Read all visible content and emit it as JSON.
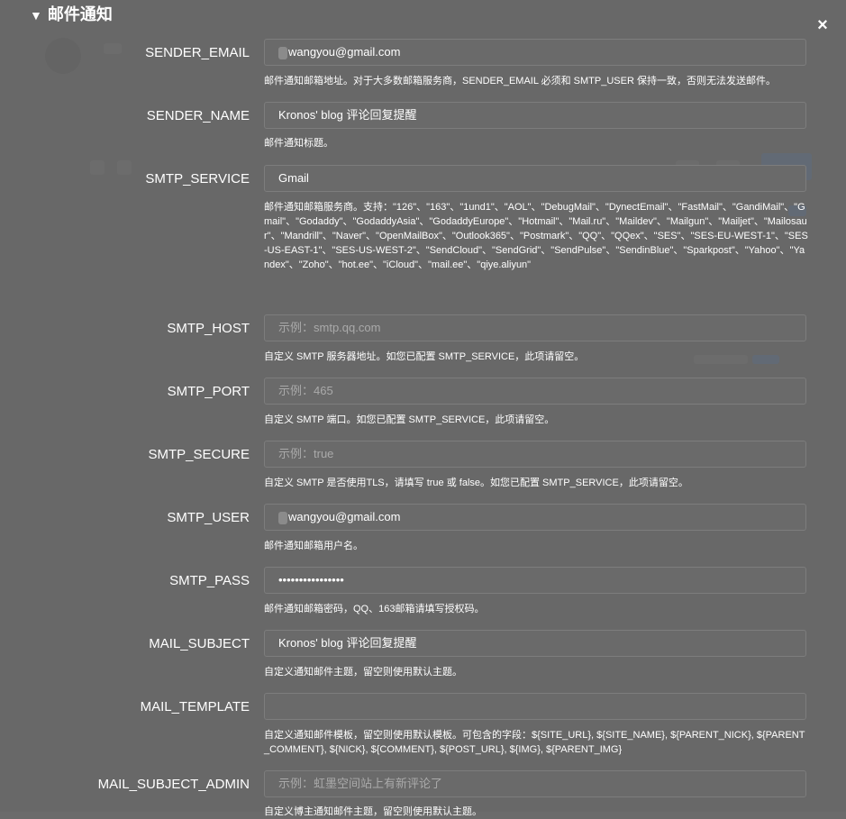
{
  "section": {
    "title": "邮件通知"
  },
  "close_label": "×",
  "fields": [
    {
      "label": "SENDER_EMAIL",
      "value": "wangyou@gmail.com",
      "placeholder": "",
      "help": "邮件通知邮箱地址。对于大多数邮箱服务商，SENDER_EMAIL 必须和 SMTP_USER 保持一致，否则无法发送邮件。"
    },
    {
      "label": "SENDER_NAME",
      "value": "Kronos' blog 评论回复提醒",
      "placeholder": "",
      "help": "邮件通知标题。"
    },
    {
      "label": "SMTP_SERVICE",
      "value": "Gmail",
      "placeholder": "",
      "help": "邮件通知邮箱服务商。支持：\"126\"、\"163\"、\"1und1\"、\"AOL\"、\"DebugMail\"、\"DynectEmail\"、\"FastMail\"、\"GandiMail\"、\"Gmail\"、\"Godaddy\"、\"GodaddyAsia\"、\"GodaddyEurope\"、\"Hotmail\"、\"Mail.ru\"、\"Maildev\"、\"Mailgun\"、\"Mailjet\"、\"Mailosaur\"、\"Mandrill\"、\"Naver\"、\"OpenMailBox\"、\"Outlook365\"、\"Postmark\"、\"QQ\"、\"QQex\"、\"SES\"、\"SES-EU-WEST-1\"、\"SES-US-EAST-1\"、\"SES-US-WEST-2\"、\"SendCloud\"、\"SendGrid\"、\"SendPulse\"、\"SendinBlue\"、\"Sparkpost\"、\"Yahoo\"、\"Yandex\"、\"Zoho\"、\"hot.ee\"、\"iCloud\"、\"mail.ee\"、\"qiye.aliyun\""
    },
    {
      "label": "SMTP_HOST",
      "value": "",
      "placeholder": "示例：smtp.qq.com",
      "help": "自定义 SMTP 服务器地址。如您已配置 SMTP_SERVICE，此项请留空。"
    },
    {
      "label": "SMTP_PORT",
      "value": "",
      "placeholder": "示例：465",
      "help": "自定义 SMTP 端口。如您已配置 SMTP_SERVICE，此项请留空。"
    },
    {
      "label": "SMTP_SECURE",
      "value": "",
      "placeholder": "示例：true",
      "help": "自定义 SMTP 是否使用TLS，请填写 true 或 false。如您已配置 SMTP_SERVICE，此项请留空。"
    },
    {
      "label": "SMTP_USER",
      "value": "wangyou@gmail.com",
      "placeholder": "",
      "help": "邮件通知邮箱用户名。"
    },
    {
      "label": "SMTP_PASS",
      "value": "••••••••••••••••",
      "placeholder": "",
      "help": "邮件通知邮箱密码，QQ、163邮箱请填写授权码。"
    },
    {
      "label": "MAIL_SUBJECT",
      "value": "Kronos' blog 评论回复提醒",
      "placeholder": "",
      "help": "自定义通知邮件主题，留空则使用默认主题。"
    },
    {
      "label": "MAIL_TEMPLATE",
      "value": "",
      "placeholder": "",
      "help": "自定义通知邮件模板，留空则使用默认模板。可包含的字段：${SITE_URL}, ${SITE_NAME}, ${PARENT_NICK}, ${PARENT_COMMENT}, ${NICK}, ${COMMENT}, ${POST_URL}, ${IMG}, ${PARENT_IMG}"
    },
    {
      "label": "MAIL_SUBJECT_ADMIN",
      "value": "",
      "placeholder": "示例：虹墨空间站上有新评论了",
      "help": "自定义博主通知邮件主题，留空则使用默认主题。"
    }
  ]
}
